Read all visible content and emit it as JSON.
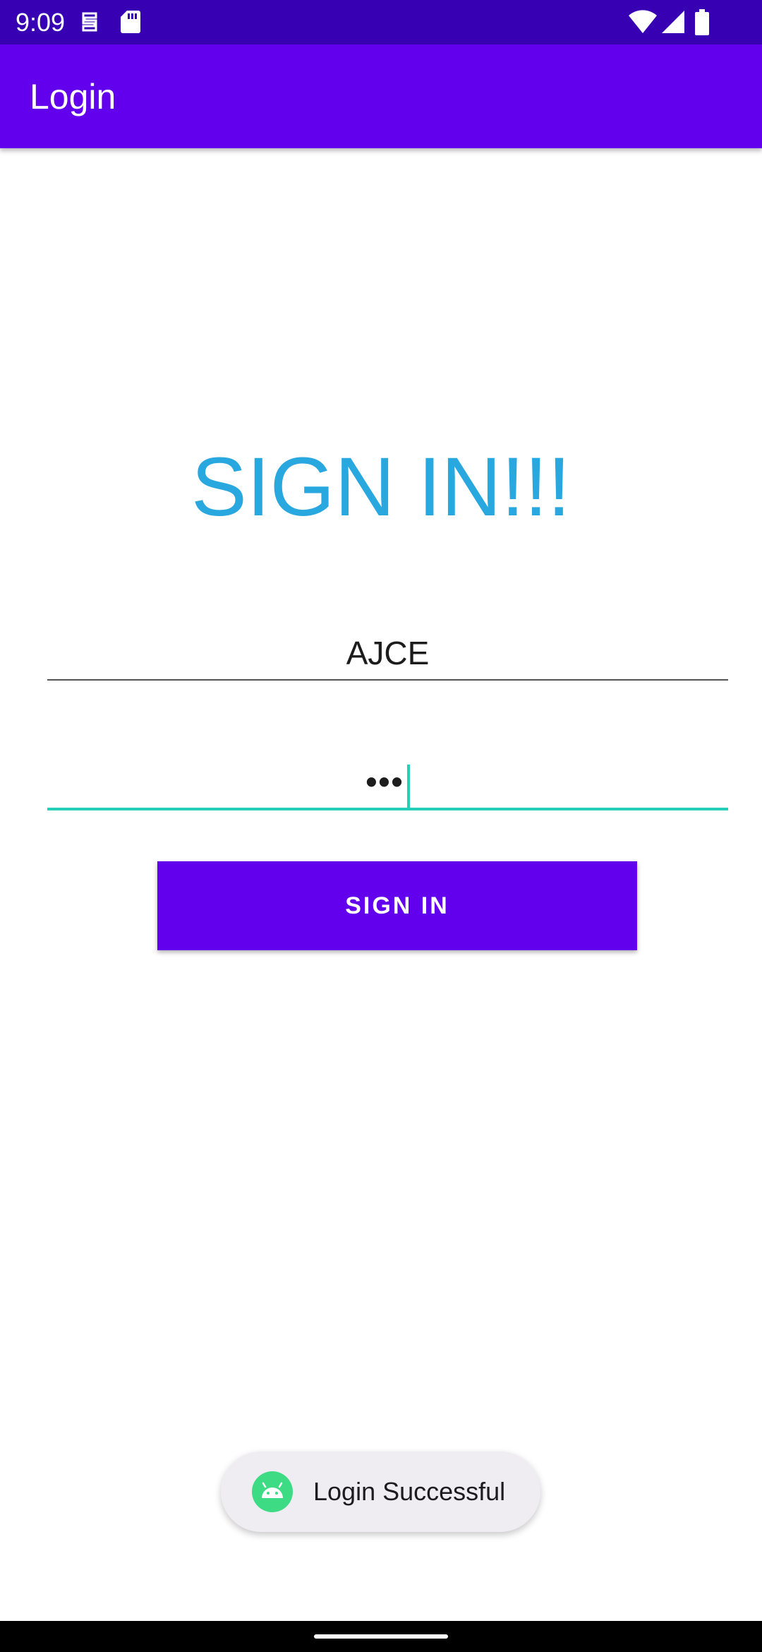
{
  "status_bar": {
    "time": "9:09",
    "icons": [
      "sim-card-toolkit-icon",
      "sd-card-icon",
      "wifi-icon",
      "signal-icon",
      "battery-icon"
    ],
    "color": "#3700b3"
  },
  "app_bar": {
    "title": "Login",
    "color": "#6200ee"
  },
  "main": {
    "heading": "SIGN IN!!!",
    "heading_color": "#29a8e0",
    "username_value": "AJCE",
    "password_value": "•••",
    "password_focus_color": "#26d0b8",
    "sign_in_label": "SIGN IN"
  },
  "toast": {
    "icon": "android-icon",
    "message": "Login Successful"
  },
  "nav_bar": {
    "handle": "home-gesture-handle"
  }
}
